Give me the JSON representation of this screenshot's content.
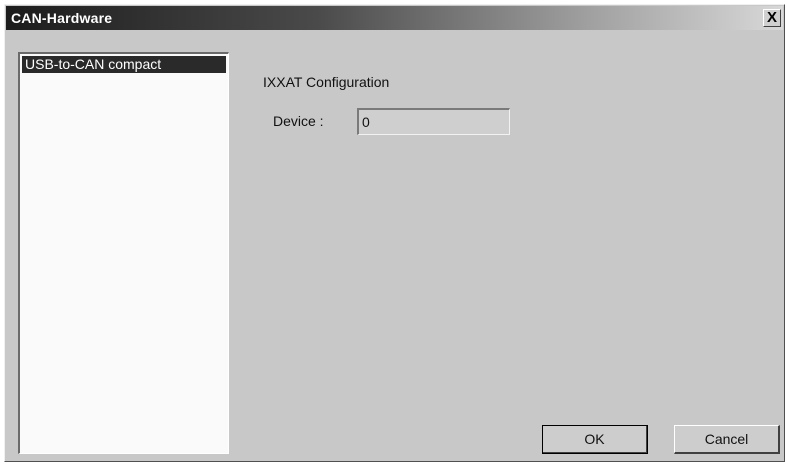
{
  "window": {
    "title": "CAN-Hardware",
    "close_symbol": "X"
  },
  "hardware_list": {
    "items": [
      {
        "label": "USB-to-CAN compact",
        "selected": true
      }
    ]
  },
  "config": {
    "group_title": "IXXAT Configuration",
    "device_label": "Device :",
    "device_value": "0"
  },
  "buttons": {
    "ok_label": "OK",
    "cancel_label": "Cancel"
  }
}
